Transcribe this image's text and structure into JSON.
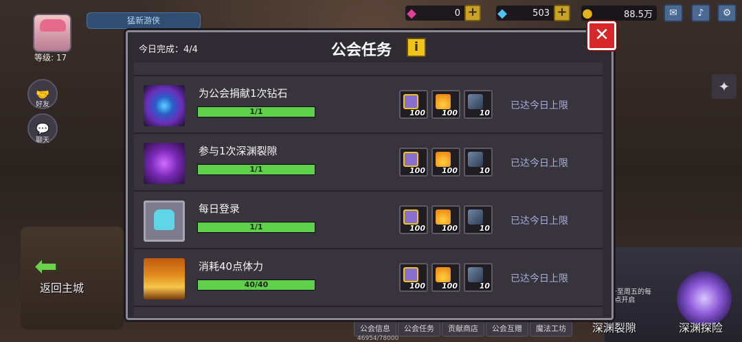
{
  "player": {
    "level_label": "等级: 17",
    "name": "猛新游侠"
  },
  "side": {
    "friends_label": "好友",
    "chat_label": "聊天"
  },
  "currency": {
    "gems": "0",
    "diamonds": "503",
    "gold": "88.5万"
  },
  "back_label": "返回主城",
  "dialog": {
    "done_text": "今日完成：4/4",
    "title": "公会任务",
    "tasks": [
      {
        "name": "为公会捐献1次钻石",
        "progress_text": "1/1",
        "progress": 1.0,
        "r1": "100",
        "r2": "100",
        "r3": "10",
        "status": "已达今日上限",
        "icon_color": "#7b3fd0"
      },
      {
        "name": "参与1次深渊裂隙",
        "progress_text": "1/1",
        "progress": 1.0,
        "r1": "100",
        "r2": "100",
        "r3": "10",
        "status": "已达今日上限",
        "icon_color": "#b04ad8"
      },
      {
        "name": "每日登录",
        "progress_text": "1/1",
        "progress": 1.0,
        "r1": "100",
        "r2": "100",
        "r3": "10",
        "status": "已达今日上限",
        "icon_color": "#5ed6e8"
      },
      {
        "name": "消耗40点体力",
        "progress_text": "40/40",
        "progress": 1.0,
        "r1": "100",
        "r2": "100",
        "r3": "10",
        "status": "已达今日上限",
        "icon_color": "#e08a1e"
      }
    ]
  },
  "tabs": [
    "公会信息",
    "公会任务",
    "贡献商店",
    "公会互赠",
    "魔法工坊"
  ],
  "bottom_big": {
    "rift": "深渊裂隙",
    "explore": "深渊探险"
  },
  "bottom_progress": "46954/78000",
  "right_caption_1": "一至周五的每",
  "right_caption_2": "8点开启",
  "colors": {
    "accent_green": "#5fd04a",
    "status_text": "#a6b0e0",
    "close_red": "#d8272a",
    "info_yellow": "#f0c419"
  }
}
